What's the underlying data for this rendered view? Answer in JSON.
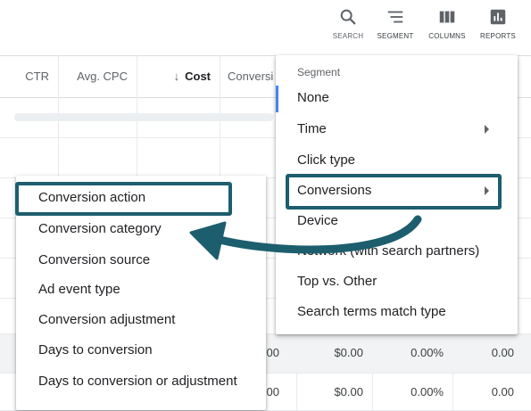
{
  "toolbar": {
    "search_label": "SEARCH",
    "segment_label": "SEGMENT",
    "columns_label": "COLUMNS",
    "reports_label": "REPORTS"
  },
  "table": {
    "headers": [
      "CTR",
      "Avg. CPC",
      "Cost",
      "Conversi"
    ],
    "sorted_column": "Cost",
    "rows": [
      {
        "c1": ".00",
        "c2": "$0.00",
        "c3": "0.00%",
        "c4": "0.00"
      },
      {
        "c1": ".00",
        "c2": "$0.00",
        "c3": "0.00%",
        "c4": "0.00"
      }
    ]
  },
  "segment_menu": {
    "title": "Segment",
    "items": [
      {
        "label": "None",
        "has_submenu": false
      },
      {
        "label": "Time",
        "has_submenu": true
      },
      {
        "label": "Click type",
        "has_submenu": false
      },
      {
        "label": "Conversions",
        "has_submenu": true
      },
      {
        "label": "Device",
        "has_submenu": false
      },
      {
        "label": "Network (with search partners)",
        "has_submenu": false
      },
      {
        "label": "Top vs. Other",
        "has_submenu": false
      },
      {
        "label": "Search terms match type",
        "has_submenu": false
      }
    ]
  },
  "conversions_submenu": {
    "items": [
      "Conversion action",
      "Conversion category",
      "Conversion source",
      "Ad event type",
      "Conversion adjustment",
      "Days to conversion",
      "Days to conversion or adjustment"
    ]
  },
  "colors": {
    "annotation": "#1d5e6e",
    "accent": "#4285f4",
    "icon": "#5f6368"
  }
}
